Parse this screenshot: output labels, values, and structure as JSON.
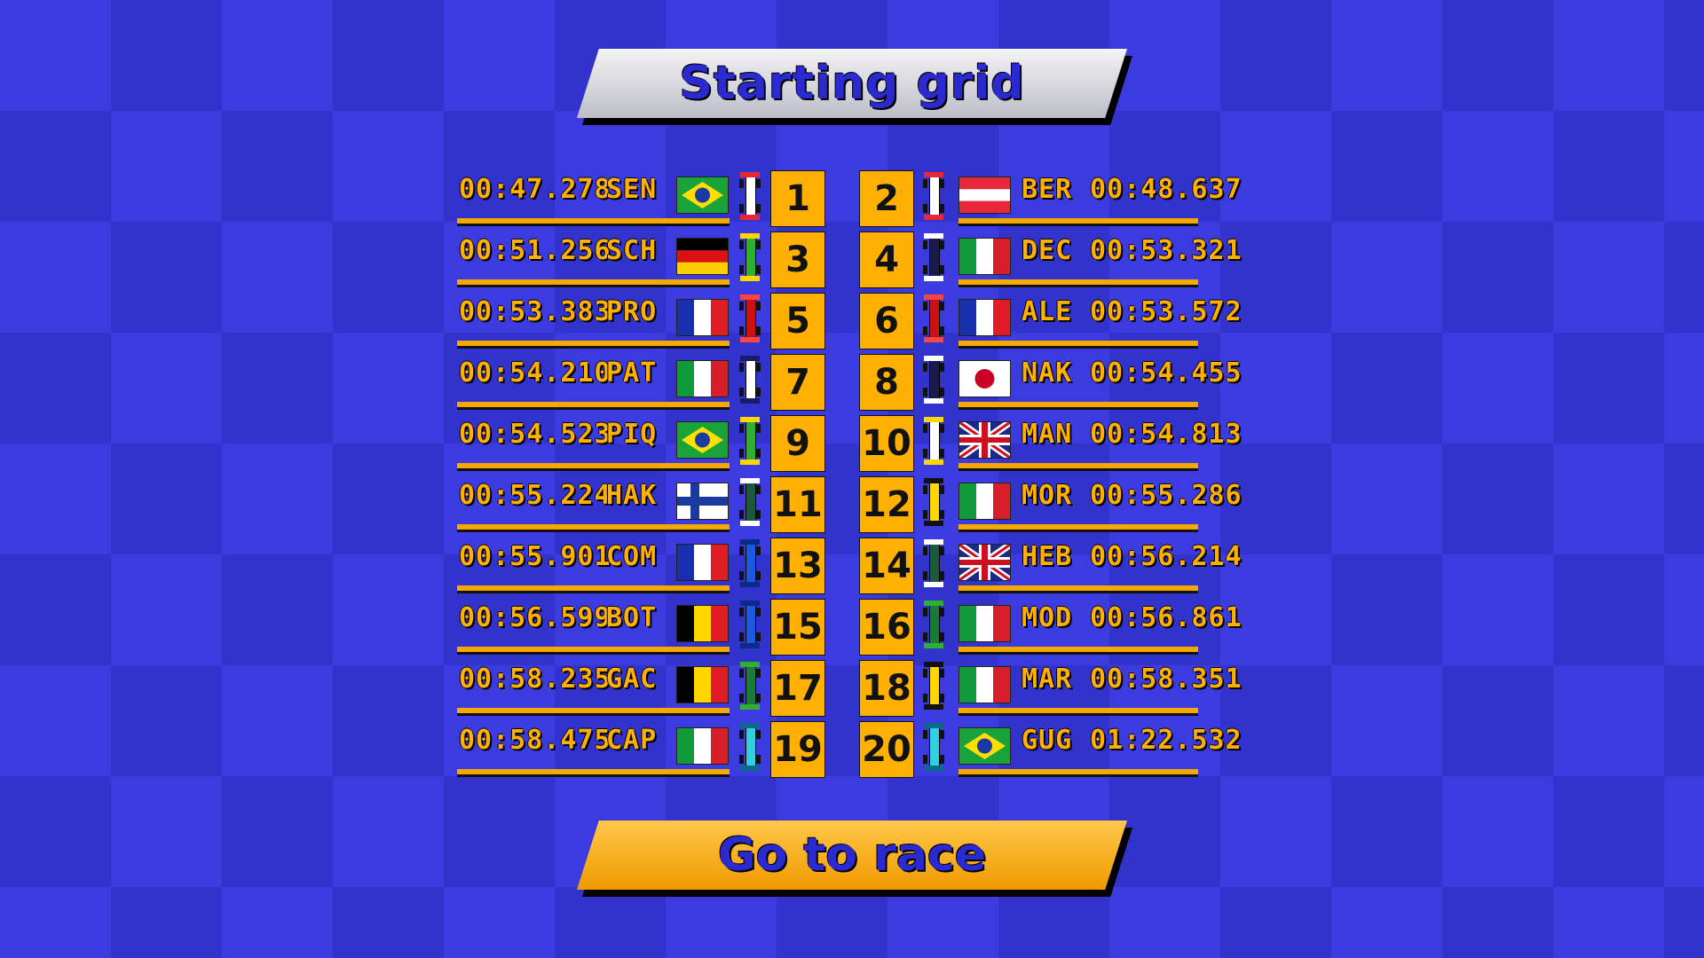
{
  "title": "Starting grid",
  "go_button": "Go to race",
  "flag_colors": {
    "brazil": [
      "#1aa33a",
      "#ffdf00",
      "#1a3aa0"
    ],
    "austria": [
      "#e8283a",
      "#ffffff",
      "#e8283a"
    ],
    "germany": [
      "#000000",
      "#dd1111",
      "#ffce00"
    ],
    "italy": [
      "#109a3a",
      "#ffffff",
      "#d81e2a"
    ],
    "france": [
      "#1830b0",
      "#ffffff",
      "#e01c24"
    ],
    "japan": [
      "#ffffff",
      "#cc0022"
    ],
    "uk": [
      "#1a2a8a",
      "#ffffff",
      "#cc1022"
    ],
    "finland": [
      "#ffffff",
      "#1a3aa0"
    ],
    "belgium": [
      "#000000",
      "#ffd700",
      "#e01c24"
    ]
  },
  "grid": [
    {
      "pos": "1",
      "time": "00:47.278",
      "code": "SEN",
      "flag": "brazil",
      "car_color": "#ffffff",
      "car_accent": "#e8283a"
    },
    {
      "pos": "2",
      "time": "00:48.637",
      "code": "BER",
      "flag": "austria",
      "car_color": "#ffffff",
      "car_accent": "#e8283a"
    },
    {
      "pos": "3",
      "time": "00:51.256",
      "code": "SCH",
      "flag": "germany",
      "car_color": "#2fb030",
      "car_accent": "#ffd700"
    },
    {
      "pos": "4",
      "time": "00:53.321",
      "code": "DEC",
      "flag": "italy",
      "car_color": "#1a1a4a",
      "car_accent": "#ffffff"
    },
    {
      "pos": "5",
      "time": "00:53.383",
      "code": "PRO",
      "flag": "france",
      "car_color": "#cc1111",
      "car_accent": "#ff4444"
    },
    {
      "pos": "6",
      "time": "00:53.572",
      "code": "ALE",
      "flag": "france",
      "car_color": "#cc1111",
      "car_accent": "#ff4444"
    },
    {
      "pos": "7",
      "time": "00:54.210",
      "code": "PAT",
      "flag": "italy",
      "car_color": "#ffffff",
      "car_accent": "#1a1a6a"
    },
    {
      "pos": "8",
      "time": "00:54.455",
      "code": "NAK",
      "flag": "japan",
      "car_color": "#1a1a4a",
      "car_accent": "#ffffff"
    },
    {
      "pos": "9",
      "time": "00:54.523",
      "code": "PIQ",
      "flag": "brazil",
      "car_color": "#2fb030",
      "car_accent": "#ffd700"
    },
    {
      "pos": "10",
      "time": "00:54.813",
      "code": "MAN",
      "flag": "uk",
      "car_color": "#ffffff",
      "car_accent": "#ffd700"
    },
    {
      "pos": "11",
      "time": "00:55.224",
      "code": "HAK",
      "flag": "finland",
      "car_color": "#1a5a3a",
      "car_accent": "#ffffff"
    },
    {
      "pos": "12",
      "time": "00:55.286",
      "code": "MOR",
      "flag": "italy",
      "car_color": "#ffd700",
      "car_accent": "#111111"
    },
    {
      "pos": "13",
      "time": "00:55.901",
      "code": "COM",
      "flag": "france",
      "car_color": "#1a5ae0",
      "car_accent": "#0a2a8a"
    },
    {
      "pos": "14",
      "time": "00:56.214",
      "code": "HEB",
      "flag": "uk",
      "car_color": "#1a5a3a",
      "car_accent": "#ffffff"
    },
    {
      "pos": "15",
      "time": "00:56.599",
      "code": "BOT",
      "flag": "belgium",
      "car_color": "#1a5ae0",
      "car_accent": "#0a2a8a"
    },
    {
      "pos": "16",
      "time": "00:56.861",
      "code": "MOD",
      "flag": "italy",
      "car_color": "#1a7a3a",
      "car_accent": "#2fb030"
    },
    {
      "pos": "17",
      "time": "00:58.235",
      "code": "GAC",
      "flag": "belgium",
      "car_color": "#1a7a3a",
      "car_accent": "#2fb030"
    },
    {
      "pos": "18",
      "time": "00:58.351",
      "code": "MAR",
      "flag": "italy",
      "car_color": "#ffd700",
      "car_accent": "#111111"
    },
    {
      "pos": "19",
      "time": "00:58.475",
      "code": "CAP",
      "flag": "italy",
      "car_color": "#30d0e0",
      "car_accent": "#0a6a8a"
    },
    {
      "pos": "20",
      "time": "01:22.532",
      "code": "GUG",
      "flag": "brazil",
      "car_color": "#30d0e0",
      "car_accent": "#0a6a8a"
    }
  ]
}
